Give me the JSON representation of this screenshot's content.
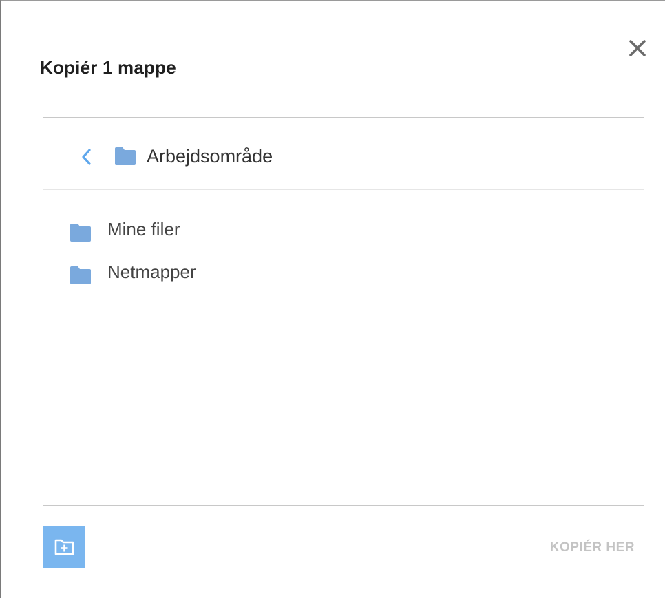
{
  "dialog": {
    "title": "Kopiér 1 mappe",
    "close_icon": "close-icon"
  },
  "browser": {
    "back_icon": "chevron-left-icon",
    "current_folder": {
      "icon": "folder-icon",
      "label": "Arbejdsområde"
    },
    "items": [
      {
        "icon": "folder-icon",
        "label": "Mine filer"
      },
      {
        "icon": "folder-icon",
        "label": "Netmapper"
      }
    ]
  },
  "footer": {
    "new_folder_icon": "new-folder-icon",
    "copy_here_label": "KOPIÉR HER"
  },
  "colors": {
    "accent": "#7ab6ef",
    "folder": "#7aa9dd",
    "disabled_text": "#c4c4c4"
  }
}
